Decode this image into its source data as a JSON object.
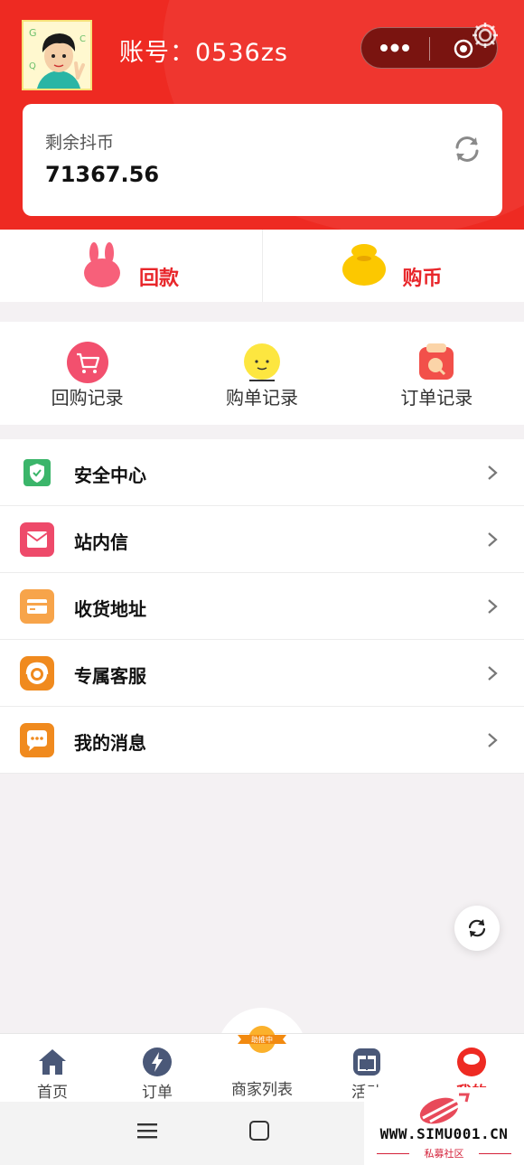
{
  "header": {
    "account_label": "账号：0536zs",
    "capsule": {
      "more_icon": "more-dots-icon",
      "close_icon": "target-icon"
    },
    "settings_icon": "gear-icon",
    "coin": {
      "label": "剩余抖币",
      "value": "71367.56",
      "refresh_icon": "refresh-icon"
    }
  },
  "actions": [
    {
      "label": "回款",
      "icon": "bunny-icon"
    },
    {
      "label": "购币",
      "icon": "money-bag-icon"
    }
  ],
  "records": [
    {
      "label": "回购记录",
      "icon": "cart-icon"
    },
    {
      "label": "购单记录",
      "icon": "smiley-icon"
    },
    {
      "label": "订单记录",
      "icon": "order-bag-icon"
    }
  ],
  "menu": [
    {
      "label": "安全中心",
      "icon": "shield-icon",
      "color": "#3bb56a"
    },
    {
      "label": "站内信",
      "icon": "mail-icon",
      "color": "#ee4a6a"
    },
    {
      "label": "收货地址",
      "icon": "card-icon",
      "color": "#f7a44a"
    },
    {
      "label": "专属客服",
      "icon": "headset-icon",
      "color": "#f08a1e"
    },
    {
      "label": "我的消息",
      "icon": "chat-icon",
      "color": "#f08a1e"
    }
  ],
  "tabbar": {
    "tabs": [
      {
        "label": "首页",
        "icon": "home-icon"
      },
      {
        "label": "订单",
        "icon": "bolt-icon"
      },
      {
        "label": "商家列表",
        "icon": "promo-badge-icon",
        "badge_text": "助推中"
      },
      {
        "label": "活动",
        "icon": "gift-icon"
      },
      {
        "label": "我的",
        "icon": "profile-icon",
        "active": true
      }
    ]
  },
  "watermark": {
    "url": "WWW.SIMU001.CN",
    "sub": "私募社区"
  },
  "colors": {
    "brand_red": "#ee2a22",
    "accent_red": "#e8262a",
    "background": "#f4f1f3"
  }
}
